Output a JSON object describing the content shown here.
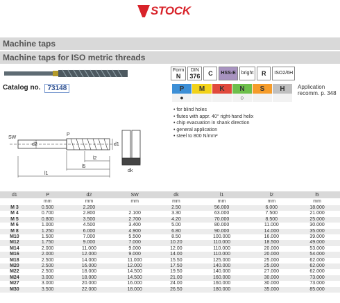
{
  "brand": "STOCK",
  "section": "Machine taps",
  "subsection": "Machine taps for ISO metric threads",
  "catalog": {
    "label": "Catalog no.",
    "number": "73148"
  },
  "icons": [
    {
      "top": "Form",
      "main": "N",
      "name": "type-icon"
    },
    {
      "top": "DIN",
      "main": "376",
      "name": "din-icon"
    },
    {
      "top": "",
      "main": "C",
      "name": "chamfer-icon"
    },
    {
      "top": "",
      "main": "HSS-E",
      "name": "material-icon"
    },
    {
      "top": "",
      "main": "bright",
      "name": "coating-icon"
    },
    {
      "top": "",
      "main": "R",
      "name": "spiral-icon"
    },
    {
      "top": "",
      "main": "ISO2/6H",
      "name": "tolerance-icon"
    }
  ],
  "materials": [
    {
      "letter": "P",
      "color": "#3d8fd6",
      "mark": "●"
    },
    {
      "letter": "M",
      "color": "#f2d21a",
      "mark": ""
    },
    {
      "letter": "K",
      "color": "#e0493c",
      "mark": ""
    },
    {
      "letter": "N",
      "color": "#6dbf4b",
      "mark": "○"
    },
    {
      "letter": "S",
      "color": "#f59c2a",
      "mark": ""
    },
    {
      "letter": "H",
      "color": "#bfbfbf",
      "mark": ""
    }
  ],
  "application": {
    "line1": "Application",
    "line2": "recomm. p. 348"
  },
  "features": [
    "for blind holes",
    "flutes with appr. 40° right-hand helix",
    "chip evacuation in shank direction",
    "general application",
    "steel to 800 N/mm²"
  ],
  "drawing_labels": {
    "sw": "SW",
    "p": "P",
    "d2": "d2",
    "l1": "l1",
    "l2": "l2",
    "l5": "l5",
    "d1": "d1",
    "dk": "dk"
  },
  "table": {
    "headers": [
      "d1",
      "P",
      "d2",
      "SW",
      "dk",
      "l1",
      "l2",
      "l5"
    ],
    "units": [
      "",
      "mm",
      "mm",
      "mm",
      "mm",
      "mm",
      "mm",
      "mm"
    ],
    "rows": [
      [
        "M 3",
        "0.500",
        "2.200",
        "",
        "2.50",
        "56.000",
        "6.000",
        "18.000"
      ],
      [
        "M 4",
        "0.700",
        "2.800",
        "2.100",
        "3.30",
        "63.000",
        "7.500",
        "21.000"
      ],
      [
        "M 5",
        "0.800",
        "3.500",
        "2.700",
        "4.20",
        "70.000",
        "8.500",
        "25.000"
      ],
      [
        "M 6",
        "1.000",
        "4.500",
        "3.400",
        "5.00",
        "80.000",
        "11.000",
        "30.000"
      ],
      [
        "M 8",
        "1.250",
        "6.000",
        "4.900",
        "6.80",
        "90.000",
        "14.000",
        "35.000"
      ],
      [
        "M10",
        "1.500",
        "7.000",
        "5.500",
        "8.50",
        "100.000",
        "16.000",
        "39.000"
      ],
      [
        "M12",
        "1.750",
        "9.000",
        "7.000",
        "10.20",
        "110.000",
        "18.500",
        "49.000"
      ],
      [
        "M14",
        "2.000",
        "11.000",
        "9.000",
        "12.00",
        "110.000",
        "20.000",
        "53.000"
      ],
      [
        "M16",
        "2.000",
        "12.000",
        "9.000",
        "14.00",
        "110.000",
        "20.000",
        "54.000"
      ],
      [
        "M18",
        "2.500",
        "14.000",
        "11.000",
        "15.50",
        "125.000",
        "25.000",
        "62.000"
      ],
      [
        "M20",
        "2.500",
        "16.000",
        "12.000",
        "17.50",
        "140.000",
        "25.000",
        "62.000"
      ],
      [
        "M22",
        "2.500",
        "18.000",
        "14.500",
        "19.50",
        "140.000",
        "27.000",
        "62.000"
      ],
      [
        "M24",
        "3.000",
        "18.000",
        "14.500",
        "21.00",
        "160.000",
        "30.000",
        "73.000"
      ],
      [
        "M27",
        "3.000",
        "20.000",
        "16.000",
        "24.00",
        "160.000",
        "30.000",
        "73.000"
      ],
      [
        "M30",
        "3.500",
        "22.000",
        "18.000",
        "26.50",
        "180.000",
        "35.000",
        "85.000"
      ]
    ]
  }
}
